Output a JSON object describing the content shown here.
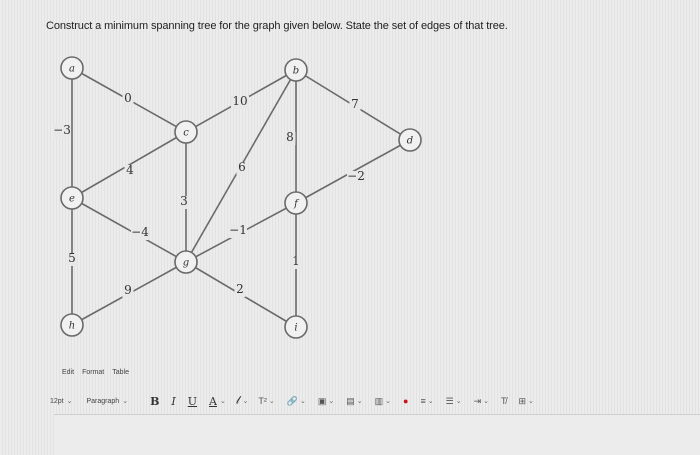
{
  "prompt": "Construct a minimum spanning tree for the graph given below. State the set of edges of that tree.",
  "graph": {
    "nodes": [
      {
        "id": "a",
        "label": "a"
      },
      {
        "id": "b",
        "label": "b"
      },
      {
        "id": "c",
        "label": "c"
      },
      {
        "id": "d",
        "label": "d"
      },
      {
        "id": "e",
        "label": "e"
      },
      {
        "id": "f",
        "label": "f"
      },
      {
        "id": "g",
        "label": "g"
      },
      {
        "id": "h",
        "label": "h"
      },
      {
        "id": "i",
        "label": "i"
      }
    ],
    "edges": [
      {
        "from": "a",
        "to": "c",
        "weight": "0"
      },
      {
        "from": "a",
        "to": "e",
        "weight": "−3"
      },
      {
        "from": "c",
        "to": "b",
        "weight": "10"
      },
      {
        "from": "b",
        "to": "d",
        "weight": "7"
      },
      {
        "from": "b",
        "to": "f",
        "weight": "8"
      },
      {
        "from": "b",
        "to": "g",
        "weight": "6"
      },
      {
        "from": "c",
        "to": "e",
        "weight": "4"
      },
      {
        "from": "c",
        "to": "g",
        "weight": "3"
      },
      {
        "from": "d",
        "to": "f",
        "weight": "−2"
      },
      {
        "from": "e",
        "to": "g",
        "weight": "−4"
      },
      {
        "from": "e",
        "to": "h",
        "weight": "5"
      },
      {
        "from": "f",
        "to": "g",
        "weight": "−1"
      },
      {
        "from": "f",
        "to": "i",
        "weight": "1"
      },
      {
        "from": "g",
        "to": "h",
        "weight": "9"
      },
      {
        "from": "g",
        "to": "i",
        "weight": "2"
      }
    ]
  },
  "editor": {
    "menu": [
      "Edit",
      "Format",
      "Table"
    ],
    "font_size": "12pt",
    "block_format": "Paragraph",
    "buttons": {
      "bold": "B",
      "italic": "I",
      "underline": "U",
      "text_color": "A",
      "highlight": "𝓁",
      "superscript": "T²"
    },
    "icons": [
      "link-icon",
      "image-icon",
      "media-icon",
      "embed-icon",
      "record-icon",
      "align-icon",
      "list-icon",
      "indent-icon",
      "clear-format-icon",
      "table-icon"
    ]
  }
}
